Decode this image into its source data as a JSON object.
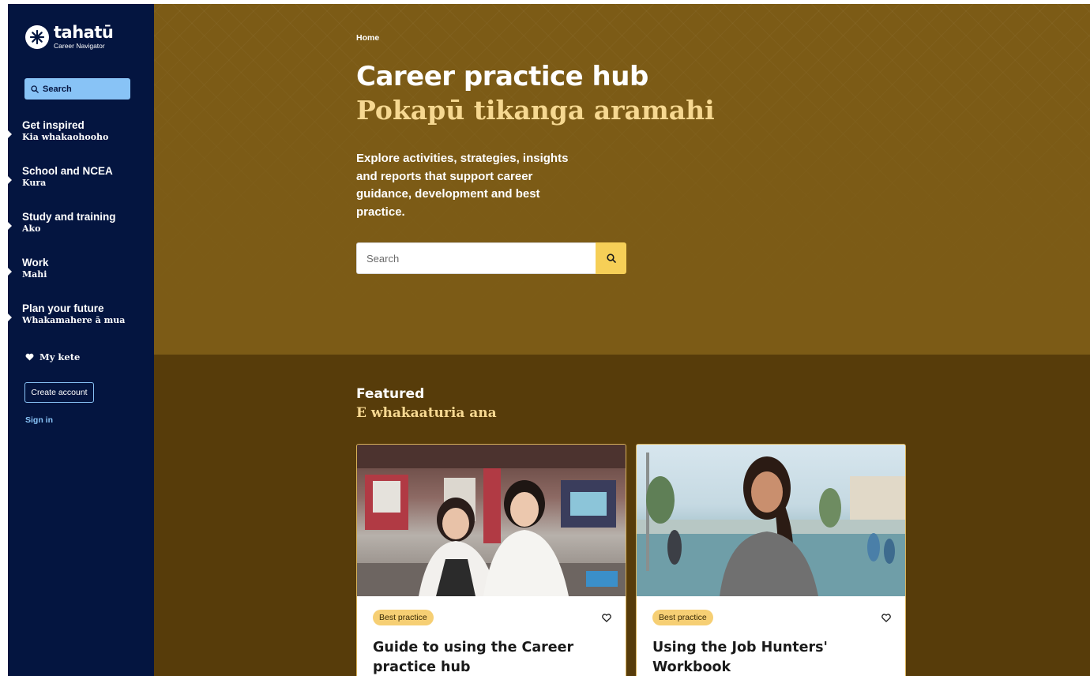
{
  "sidebar": {
    "logo": {
      "name": "tahatū",
      "subtitle": "Career Navigator"
    },
    "search_label": "Search",
    "nav": [
      {
        "en": "Get inspired",
        "mi": "Kia whakaohooho"
      },
      {
        "en": "School and NCEA",
        "mi": "Kura"
      },
      {
        "en": "Study and training",
        "mi": "Ako"
      },
      {
        "en": "Work",
        "mi": "Mahi"
      },
      {
        "en": "Plan your future",
        "mi": "Whakamahere ā mua"
      }
    ],
    "my_kete": "My kete",
    "create_account": "Create account",
    "sign_in": "Sign in"
  },
  "hero": {
    "breadcrumb": "Home",
    "title_en": "Career practice hub",
    "title_mi": "Pokapū tikanga aramahi",
    "intro": "Explore activities, strategies, insights and reports that support career guidance, development and best practice.",
    "search_placeholder": "Search"
  },
  "featured": {
    "heading_en": "Featured",
    "heading_mi": "E whakaaturia ana",
    "cards": [
      {
        "tag": "Best practice",
        "title": "Guide to using the Career practice hub"
      },
      {
        "tag": "Best practice",
        "title": "Using the Job Hunters' Workbook"
      }
    ]
  },
  "colors": {
    "sidebar_bg": "#041540",
    "hero_bg": "#7c5b16",
    "featured_bg": "#573c0a",
    "accent_yellow": "#f6cf57",
    "maori_text": "#f6d891",
    "link_blue": "#88c3f6"
  }
}
